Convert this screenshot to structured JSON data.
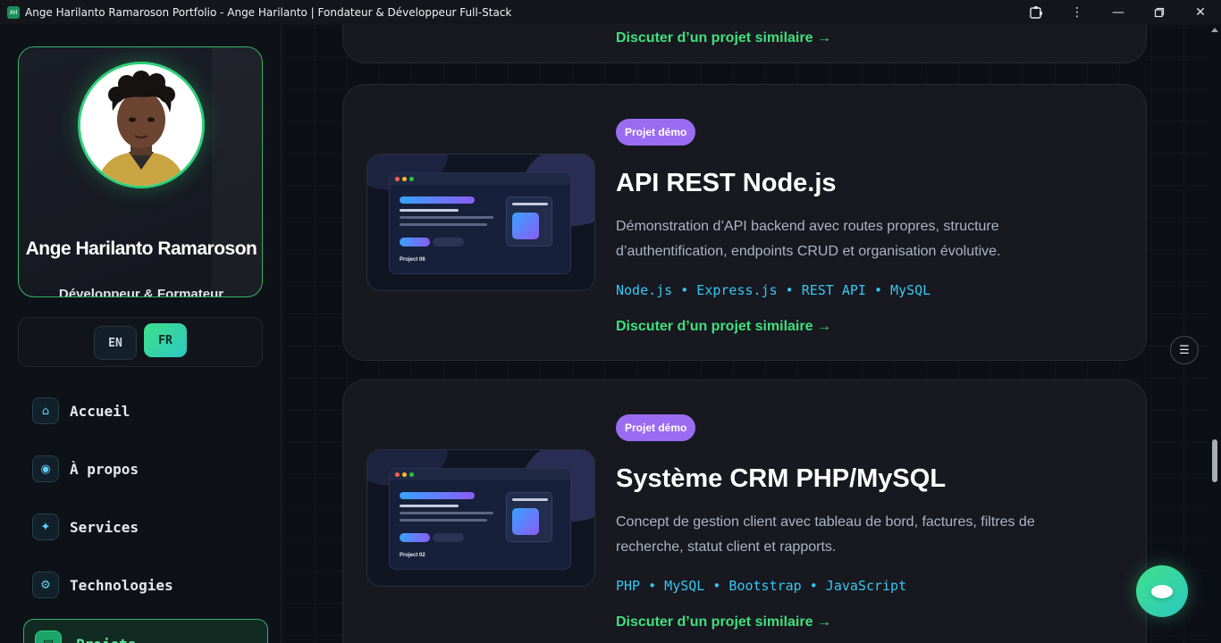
{
  "window": {
    "title": "Ange Harilanto Ramaroson Portfolio - Ange Harilanto | Fondateur & Développeur Full-Stack",
    "app_icon_text": "AH"
  },
  "sidebar": {
    "profile": {
      "name": "Ange Harilanto Ramaroson",
      "role": "Développeur & Formateur"
    },
    "languages": {
      "en": "EN",
      "fr": "FR",
      "active": "FR"
    },
    "nav": [
      {
        "label": "Accueil",
        "icon": "home-icon",
        "glyph": "⌂"
      },
      {
        "label": "À propos",
        "icon": "user-circle-icon",
        "glyph": "◉"
      },
      {
        "label": "Services",
        "icon": "sparkle-icon",
        "glyph": "✦"
      },
      {
        "label": "Technologies",
        "icon": "gear-icon",
        "glyph": "⚙"
      },
      {
        "label": "Projets",
        "icon": "folder-icon",
        "glyph": "▤",
        "active": true
      }
    ]
  },
  "projects": {
    "previous_link": "Discuter d’un projet similaire →",
    "items": [
      {
        "badge": "Projet démo",
        "title": "API REST Node.js",
        "description": "Démonstration d’API backend avec routes propres, structure d’authentification, endpoints CRUD et organisation évolutive.",
        "tech": "Node.js • Express.js • REST API • MySQL",
        "link": "Discuter d’un projet similaire →",
        "thumb_caption": "Project 06"
      },
      {
        "badge": "Projet démo",
        "title": "Système CRM PHP/MySQL",
        "description": "Concept de gestion client avec tableau de bord, factures, filtres de recherche, statut client et rapports.",
        "tech": "PHP • MySQL • Bootstrap • JavaScript",
        "link": "Discuter d’un projet similaire →",
        "thumb_caption": "Project 02"
      }
    ]
  },
  "colors": {
    "accent_green": "#3fe07d",
    "badge_purple": "#9b6cf2",
    "tech_cyan": "#35c8f0",
    "background": "#0d0f17"
  }
}
